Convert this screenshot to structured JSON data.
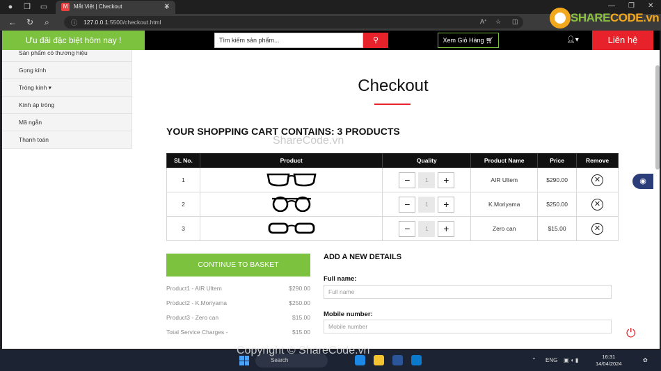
{
  "browser": {
    "tab_title": "Mắt Việt | Checkout",
    "tab_favicon": "M",
    "url_host": "127.0.0.1",
    "url_rest": ":5500/checkout.html"
  },
  "watermarks": {
    "logo_share": "SHARE",
    "logo_code": "CODE.vn",
    "center": "ShareCode.vn",
    "bottom": "Copyright © ShareCode.vn"
  },
  "header": {
    "promo": "Ưu đãi đặc biệt hôm nay !",
    "search_placeholder": "Tìm kiếm sản phẩm...",
    "cart_label": "Xem Giỏ Hàng",
    "contact_label": "Liên hệ"
  },
  "sidebar": {
    "items": [
      {
        "label": "Sản phẩm có thương hiệu"
      },
      {
        "label": "Gọng kính"
      },
      {
        "label": "Tròng kính ▾"
      },
      {
        "label": "Kính áp tròng"
      },
      {
        "label": "Mã ngẫn"
      },
      {
        "label": "Thanh toán"
      }
    ]
  },
  "main": {
    "title": "Checkout",
    "cart_heading": "YOUR SHOPPING CART CONTAINS: 3 PRODUCTS",
    "columns": [
      "SL No.",
      "Product",
      "Quality",
      "Product Name",
      "Price",
      "Remove"
    ],
    "rows": [
      {
        "sl": "1",
        "qty": "1",
        "name": "AIR Ultem",
        "price": "$290.00"
      },
      {
        "sl": "2",
        "qty": "1",
        "name": "K.Moriyama",
        "price": "$250.00"
      },
      {
        "sl": "3",
        "qty": "1",
        "name": "Zero can",
        "price": "$15.00"
      }
    ],
    "continue_label": "CONTINUE TO BASKET",
    "summary": [
      {
        "label": "Product1 - AIR Ultem",
        "amount": "$290.00"
      },
      {
        "label": "Product2 - K.Moriyama",
        "amount": "$250.00"
      },
      {
        "label": "Product3 - Zero can",
        "amount": "$15.00"
      },
      {
        "label": "Total Service Charges -",
        "amount": "$15.00"
      }
    ],
    "details_heading": "ADD A NEW DETAILS",
    "full_name_label": "Full name:",
    "full_name_placeholder": "Full name",
    "mobile_label": "Mobile number:",
    "mobile_placeholder": "Mobile number"
  },
  "taskbar": {
    "search": "Search",
    "lang": "ENG",
    "time": "16:31",
    "date": "14/04/2024"
  },
  "colors": {
    "accent_green": "#7cc23f",
    "accent_red": "#e8222a"
  }
}
